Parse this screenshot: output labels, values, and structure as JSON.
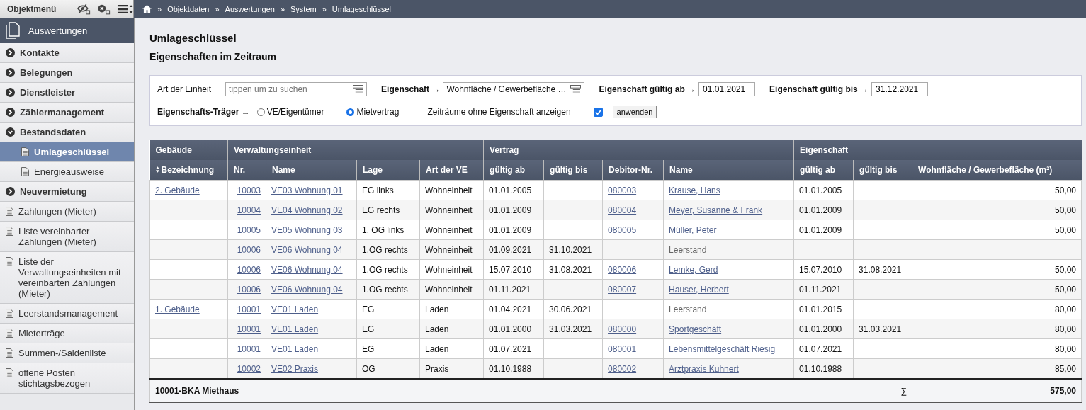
{
  "sidebar": {
    "title": "Objektmenü",
    "header": "Auswertungen",
    "items": [
      {
        "kind": "section",
        "label": "Kontakte",
        "expanded": false
      },
      {
        "kind": "section",
        "label": "Belegungen",
        "expanded": false
      },
      {
        "kind": "section",
        "label": "Dienstleister",
        "expanded": false
      },
      {
        "kind": "section",
        "label": "Zählermanagement",
        "expanded": false
      },
      {
        "kind": "section",
        "label": "Bestandsdaten",
        "expanded": true,
        "children": [
          {
            "label": "Umlageschlüssel",
            "selected": true
          },
          {
            "label": "Energieausweise",
            "selected": false
          }
        ]
      },
      {
        "kind": "section",
        "label": "Neuvermietung",
        "expanded": false
      },
      {
        "kind": "page",
        "label": "Zahlungen (Mieter)"
      },
      {
        "kind": "page",
        "label": "Liste vereinbarter Zahlungen (Mieter)"
      },
      {
        "kind": "page",
        "label": "Liste der Verwaltungseinheiten mit vereinbarten Zahlungen (Mieter)"
      },
      {
        "kind": "page",
        "label": "Leerstandsmanagement"
      },
      {
        "kind": "page",
        "label": "Mieterträge"
      },
      {
        "kind": "page",
        "label": "Summen-/Saldenliste"
      },
      {
        "kind": "page",
        "label": "offene Posten stichtagsbezogen"
      }
    ]
  },
  "breadcrumb": {
    "separator": "»",
    "items": [
      "Objektdaten",
      "Auswertungen",
      "System",
      "Umlageschlüssel"
    ]
  },
  "page_title": "Umlageschlüssel",
  "subtitle": "Eigenschaften im Zeitraum",
  "filter": {
    "unit_label": "Art der Einheit",
    "unit_placeholder": "tippen um zu suchen",
    "property_label": "Eigenschaft →",
    "property_value": "Wohnfläche / Gewerbefläche …",
    "from_label": "Eigenschaft gültig ab →",
    "from_value": "01.01.2021",
    "to_label": "Eigenschaft gültig bis →",
    "to_value": "31.12.2021",
    "carrier_label": "Eigenschafts-Träger →",
    "carriers": [
      {
        "label": "VE/Eigentümer",
        "selected": false
      },
      {
        "label": "Mietvertrag",
        "selected": true
      }
    ],
    "show_empty_label": "Zeiträume ohne Eigenschaft anzeigen",
    "show_empty": true,
    "apply": "anwenden"
  },
  "table": {
    "groups": [
      {
        "label": "Gebäude",
        "columns": [
          "Bezeichnung"
        ]
      },
      {
        "label": "Verwaltungseinheit",
        "columns": [
          "Nr.",
          "Name",
          "Lage",
          "Art der VE"
        ]
      },
      {
        "label": "Vertrag",
        "columns": [
          "gültig ab",
          "gültig bis",
          "Debitor-Nr.",
          "Name"
        ]
      },
      {
        "label": "Eigenschaft",
        "columns": [
          "gültig ab",
          "gültig bis",
          "Wohnfläche / Gewerbefläche (m²)"
        ]
      }
    ],
    "rows": [
      {
        "building": "2. Gebäude",
        "nr": "10003",
        "ve": "VE03 Wohnung 01",
        "lage": "EG links",
        "art": "Wohneinheit",
        "from": "01.01.2005",
        "debitor": "080003",
        "name": "Krause, Hans",
        "vacant": false,
        "p_from": "01.01.2005",
        "area": "50,00"
      },
      {
        "nr": "10004",
        "ve": "VE04 Wohnung 02",
        "lage": "EG rechts",
        "art": "Wohneinheit",
        "from": "01.01.2009",
        "debitor": "080004",
        "name": "Meyer, Susanne & Frank",
        "vacant": false,
        "p_from": "01.01.2009",
        "area": "50,00"
      },
      {
        "nr": "10005",
        "ve": "VE05 Wohnung 03",
        "lage": "1. OG links",
        "art": "Wohneinheit",
        "from": "01.01.2009",
        "debitor": "080005",
        "name": "Müller, Peter",
        "vacant": false,
        "p_from": "01.01.2009",
        "area": "50,00"
      },
      {
        "nr": "10006",
        "ve": "VE06 Wohnung 04",
        "lage": "1.OG rechts",
        "art": "Wohneinheit",
        "from": "01.09.2021",
        "to": "31.10.2021",
        "name": "Leerstand",
        "vacant": true
      },
      {
        "nr": "10006",
        "ve": "VE06 Wohnung 04",
        "lage": "1.OG rechts",
        "art": "Wohneinheit",
        "from": "15.07.2010",
        "to": "31.08.2021",
        "debitor": "080006",
        "name": "Lemke, Gerd",
        "vacant": false,
        "p_from": "15.07.2010",
        "p_to": "31.08.2021",
        "area": "50,00"
      },
      {
        "nr": "10006",
        "ve": "VE06 Wohnung 04",
        "lage": "1.OG rechts",
        "art": "Wohneinheit",
        "from": "01.11.2021",
        "debitor": "080007",
        "name": "Hauser, Herbert",
        "vacant": false,
        "p_from": "01.11.2021",
        "area": "50,00"
      },
      {
        "building": "1. Gebäude",
        "nr": "10001",
        "ve": "VE01 Laden",
        "lage": "EG",
        "art": "Laden",
        "from": "01.04.2021",
        "to": "30.06.2021",
        "name": "Leerstand",
        "vacant": true,
        "p_from": "01.01.2015",
        "area": "80,00"
      },
      {
        "nr": "10001",
        "ve": "VE01 Laden",
        "lage": "EG",
        "art": "Laden",
        "from": "01.01.2000",
        "to": "31.03.2021",
        "debitor": "080000",
        "name": "Sportgeschäft",
        "vacant": false,
        "p_from": "01.01.2000",
        "p_to": "31.03.2021",
        "area": "80,00"
      },
      {
        "nr": "10001",
        "ve": "VE01 Laden",
        "lage": "EG",
        "art": "Laden",
        "from": "01.07.2021",
        "debitor": "080001",
        "name": "Lebensmittelgeschäft Riesig",
        "vacant": false,
        "p_from": "01.07.2021",
        "area": "80,00"
      },
      {
        "nr": "10002",
        "ve": "VE02 Praxis",
        "lage": "OG",
        "art": "Praxis",
        "from": "01.10.1988",
        "debitor": "080002",
        "name": "Arztpraxis Kuhnert",
        "vacant": false,
        "p_from": "01.10.1988",
        "area": "85,00"
      }
    ],
    "footer": {
      "label": "10001-BKA Miethaus",
      "sum_sign": "∑",
      "total": "575,00"
    }
  }
}
